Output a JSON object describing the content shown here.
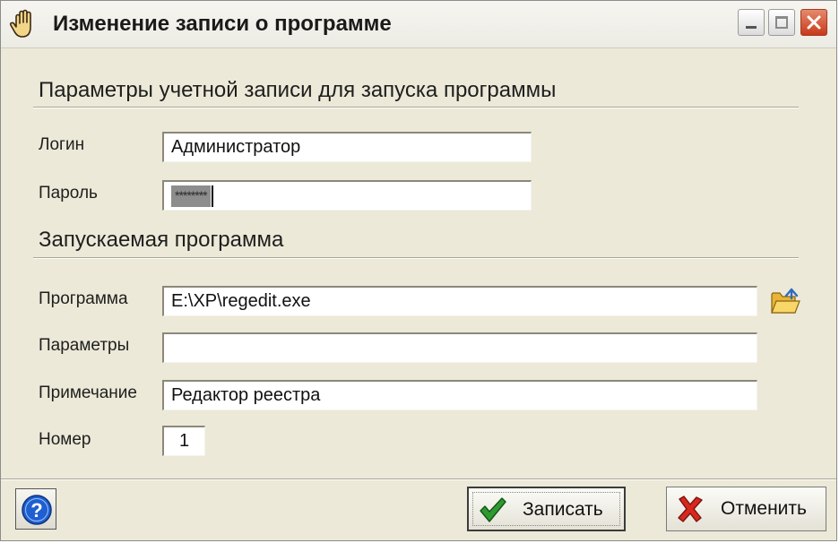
{
  "window": {
    "title": "Изменение записи о программе",
    "icon": "hand-icon",
    "controls": [
      "minimize",
      "maximize",
      "close"
    ]
  },
  "account_section": {
    "title": "Параметры учетной записи для запуска программы",
    "login_label": "Логин",
    "login_value": "Администратор",
    "password_label": "Пароль",
    "password_value": "********"
  },
  "program_section": {
    "title": "Запускаемая программа",
    "program_label": "Программа",
    "program_value": "E:\\XP\\regedit.exe",
    "browse_icon": "folder-open-icon",
    "params_label": "Параметры",
    "params_value": "",
    "note_label": "Примечание",
    "note_value": "Редактор реестра",
    "number_label": "Номер",
    "number_value": "1"
  },
  "buttons": {
    "help_icon": "help-icon",
    "save_label": "Записать",
    "save_icon": "checkmark-icon",
    "cancel_label": "Отменить",
    "cancel_icon": "cross-icon"
  },
  "colors": {
    "window_bg": "#ece9d8",
    "close_button": "#c8391b",
    "check_green": "#2f9a2f",
    "cross_red": "#d8281e",
    "help_blue": "#1f5fd0"
  }
}
